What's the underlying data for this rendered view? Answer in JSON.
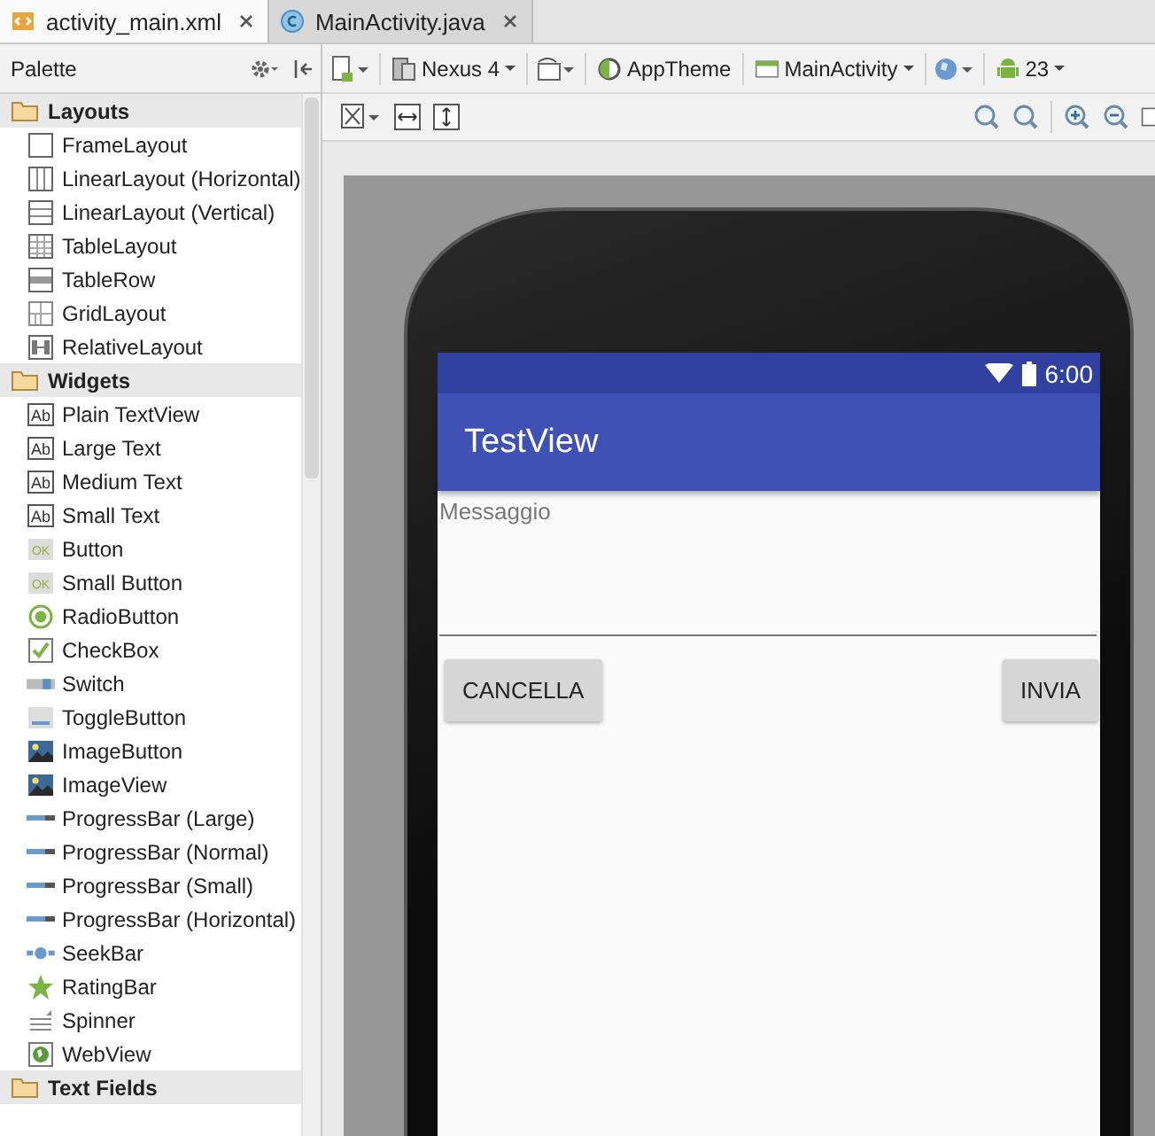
{
  "tabs": [
    {
      "label": "activity_main.xml",
      "selected": true,
      "kind": "xml"
    },
    {
      "label": "MainActivity.java",
      "selected": false,
      "kind": "class"
    }
  ],
  "palette": {
    "title": "Palette",
    "sections": [
      {
        "label": "Layouts",
        "items": [
          {
            "label": "FrameLayout",
            "kind": "frame"
          },
          {
            "label": "LinearLayout (Horizontal)",
            "kind": "columns"
          },
          {
            "label": "LinearLayout (Vertical)",
            "kind": "rows"
          },
          {
            "label": "TableLayout",
            "kind": "table"
          },
          {
            "label": "TableRow",
            "kind": "tablerow"
          },
          {
            "label": "GridLayout",
            "kind": "grid"
          },
          {
            "label": "RelativeLayout",
            "kind": "relative"
          }
        ]
      },
      {
        "label": "Widgets",
        "items": [
          {
            "label": "Plain TextView",
            "kind": "text",
            "badge": "Ab"
          },
          {
            "label": "Large Text",
            "kind": "text",
            "badge": "Ab"
          },
          {
            "label": "Medium Text",
            "kind": "text",
            "badge": "Ab"
          },
          {
            "label": "Small Text",
            "kind": "text",
            "badge": "Ab"
          },
          {
            "label": "Button",
            "kind": "ok",
            "badge": "OK"
          },
          {
            "label": "Small Button",
            "kind": "ok",
            "badge": "OK"
          },
          {
            "label": "RadioButton",
            "kind": "radio"
          },
          {
            "label": "CheckBox",
            "kind": "check"
          },
          {
            "label": "Switch",
            "kind": "switch"
          },
          {
            "label": "ToggleButton",
            "kind": "toggle"
          },
          {
            "label": "ImageButton",
            "kind": "image"
          },
          {
            "label": "ImageView",
            "kind": "image"
          },
          {
            "label": "ProgressBar (Large)",
            "kind": "progress"
          },
          {
            "label": "ProgressBar (Normal)",
            "kind": "progress"
          },
          {
            "label": "ProgressBar (Small)",
            "kind": "progress"
          },
          {
            "label": "ProgressBar (Horizontal)",
            "kind": "progress"
          },
          {
            "label": "SeekBar",
            "kind": "seek"
          },
          {
            "label": "RatingBar",
            "kind": "star"
          },
          {
            "label": "Spinner",
            "kind": "spinner"
          },
          {
            "label": "WebView",
            "kind": "web"
          }
        ]
      },
      {
        "label": "Text Fields"
      }
    ]
  },
  "toolbar": {
    "device": "Nexus 4",
    "theme": "AppTheme",
    "activity": "MainActivity",
    "api": "23"
  },
  "phone": {
    "time": "6:00",
    "app_title": "TestView",
    "field": {
      "placeholder": "Messaggio"
    },
    "buttons": [
      "CANCELLA",
      "INVIA"
    ]
  }
}
